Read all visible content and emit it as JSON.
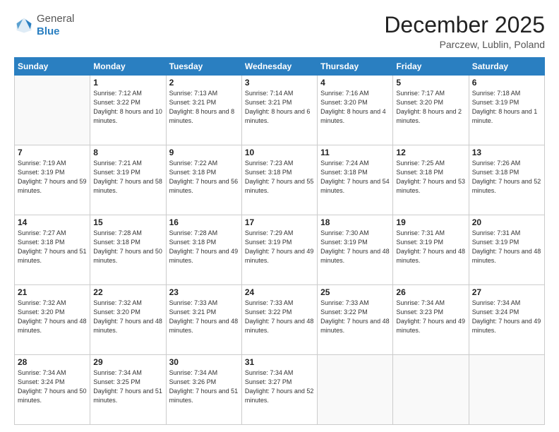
{
  "header": {
    "logo_general": "General",
    "logo_blue": "Blue",
    "month": "December 2025",
    "location": "Parczew, Lublin, Poland"
  },
  "weekdays": [
    "Sunday",
    "Monday",
    "Tuesday",
    "Wednesday",
    "Thursday",
    "Friday",
    "Saturday"
  ],
  "weeks": [
    [
      {
        "day": "",
        "sunrise": "",
        "sunset": "",
        "daylight": ""
      },
      {
        "day": "1",
        "sunrise": "7:12 AM",
        "sunset": "3:22 PM",
        "daylight": "8 hours and 10 minutes."
      },
      {
        "day": "2",
        "sunrise": "7:13 AM",
        "sunset": "3:21 PM",
        "daylight": "8 hours and 8 minutes."
      },
      {
        "day": "3",
        "sunrise": "7:14 AM",
        "sunset": "3:21 PM",
        "daylight": "8 hours and 6 minutes."
      },
      {
        "day": "4",
        "sunrise": "7:16 AM",
        "sunset": "3:20 PM",
        "daylight": "8 hours and 4 minutes."
      },
      {
        "day": "5",
        "sunrise": "7:17 AM",
        "sunset": "3:20 PM",
        "daylight": "8 hours and 2 minutes."
      },
      {
        "day": "6",
        "sunrise": "7:18 AM",
        "sunset": "3:19 PM",
        "daylight": "8 hours and 1 minute."
      }
    ],
    [
      {
        "day": "7",
        "sunrise": "7:19 AM",
        "sunset": "3:19 PM",
        "daylight": "7 hours and 59 minutes."
      },
      {
        "day": "8",
        "sunrise": "7:21 AM",
        "sunset": "3:19 PM",
        "daylight": "7 hours and 58 minutes."
      },
      {
        "day": "9",
        "sunrise": "7:22 AM",
        "sunset": "3:18 PM",
        "daylight": "7 hours and 56 minutes."
      },
      {
        "day": "10",
        "sunrise": "7:23 AM",
        "sunset": "3:18 PM",
        "daylight": "7 hours and 55 minutes."
      },
      {
        "day": "11",
        "sunrise": "7:24 AM",
        "sunset": "3:18 PM",
        "daylight": "7 hours and 54 minutes."
      },
      {
        "day": "12",
        "sunrise": "7:25 AM",
        "sunset": "3:18 PM",
        "daylight": "7 hours and 53 minutes."
      },
      {
        "day": "13",
        "sunrise": "7:26 AM",
        "sunset": "3:18 PM",
        "daylight": "7 hours and 52 minutes."
      }
    ],
    [
      {
        "day": "14",
        "sunrise": "7:27 AM",
        "sunset": "3:18 PM",
        "daylight": "7 hours and 51 minutes."
      },
      {
        "day": "15",
        "sunrise": "7:28 AM",
        "sunset": "3:18 PM",
        "daylight": "7 hours and 50 minutes."
      },
      {
        "day": "16",
        "sunrise": "7:28 AM",
        "sunset": "3:18 PM",
        "daylight": "7 hours and 49 minutes."
      },
      {
        "day": "17",
        "sunrise": "7:29 AM",
        "sunset": "3:19 PM",
        "daylight": "7 hours and 49 minutes."
      },
      {
        "day": "18",
        "sunrise": "7:30 AM",
        "sunset": "3:19 PM",
        "daylight": "7 hours and 48 minutes."
      },
      {
        "day": "19",
        "sunrise": "7:31 AM",
        "sunset": "3:19 PM",
        "daylight": "7 hours and 48 minutes."
      },
      {
        "day": "20",
        "sunrise": "7:31 AM",
        "sunset": "3:19 PM",
        "daylight": "7 hours and 48 minutes."
      }
    ],
    [
      {
        "day": "21",
        "sunrise": "7:32 AM",
        "sunset": "3:20 PM",
        "daylight": "7 hours and 48 minutes."
      },
      {
        "day": "22",
        "sunrise": "7:32 AM",
        "sunset": "3:20 PM",
        "daylight": "7 hours and 48 minutes."
      },
      {
        "day": "23",
        "sunrise": "7:33 AM",
        "sunset": "3:21 PM",
        "daylight": "7 hours and 48 minutes."
      },
      {
        "day": "24",
        "sunrise": "7:33 AM",
        "sunset": "3:22 PM",
        "daylight": "7 hours and 48 minutes."
      },
      {
        "day": "25",
        "sunrise": "7:33 AM",
        "sunset": "3:22 PM",
        "daylight": "7 hours and 48 minutes."
      },
      {
        "day": "26",
        "sunrise": "7:34 AM",
        "sunset": "3:23 PM",
        "daylight": "7 hours and 49 minutes."
      },
      {
        "day": "27",
        "sunrise": "7:34 AM",
        "sunset": "3:24 PM",
        "daylight": "7 hours and 49 minutes."
      }
    ],
    [
      {
        "day": "28",
        "sunrise": "7:34 AM",
        "sunset": "3:24 PM",
        "daylight": "7 hours and 50 minutes."
      },
      {
        "day": "29",
        "sunrise": "7:34 AM",
        "sunset": "3:25 PM",
        "daylight": "7 hours and 51 minutes."
      },
      {
        "day": "30",
        "sunrise": "7:34 AM",
        "sunset": "3:26 PM",
        "daylight": "7 hours and 51 minutes."
      },
      {
        "day": "31",
        "sunrise": "7:34 AM",
        "sunset": "3:27 PM",
        "daylight": "7 hours and 52 minutes."
      },
      {
        "day": "",
        "sunrise": "",
        "sunset": "",
        "daylight": ""
      },
      {
        "day": "",
        "sunrise": "",
        "sunset": "",
        "daylight": ""
      },
      {
        "day": "",
        "sunrise": "",
        "sunset": "",
        "daylight": ""
      }
    ]
  ]
}
